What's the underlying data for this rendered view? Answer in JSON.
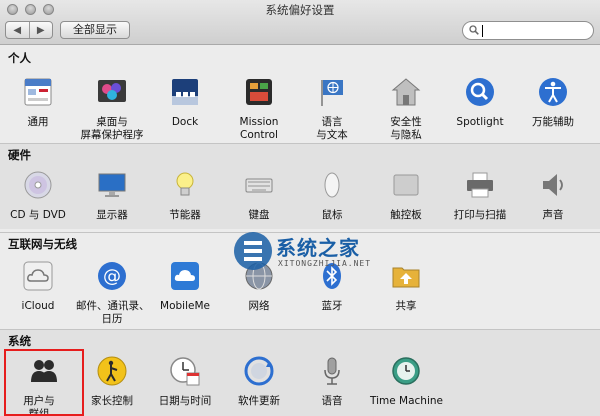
{
  "window": {
    "title": "系统偏好设置"
  },
  "toolbar": {
    "back": "◀",
    "forward": "▶",
    "show_all": "全部显示",
    "search_value": ""
  },
  "sections": [
    {
      "label": "个人",
      "items": [
        {
          "id": "general",
          "label": "通用"
        },
        {
          "id": "desktop",
          "label": "桌面与",
          "label2": "屏幕保护程序"
        },
        {
          "id": "dock",
          "label": "Dock"
        },
        {
          "id": "mission",
          "label": "Mission",
          "label2": "Control"
        },
        {
          "id": "language",
          "label": "语言",
          "label2": "与文本"
        },
        {
          "id": "security",
          "label": "安全性",
          "label2": "与隐私"
        },
        {
          "id": "spotlight",
          "label": "Spotlight"
        },
        {
          "id": "accessibility",
          "label": "万能辅助"
        }
      ]
    },
    {
      "label": "硬件",
      "items": [
        {
          "id": "cddvd",
          "label": "CD 与 DVD"
        },
        {
          "id": "display",
          "label": "显示器"
        },
        {
          "id": "energy",
          "label": "节能器"
        },
        {
          "id": "keyboard",
          "label": "键盘"
        },
        {
          "id": "mouse",
          "label": "鼠标"
        },
        {
          "id": "trackpad",
          "label": "触控板"
        },
        {
          "id": "print",
          "label": "打印与扫描"
        },
        {
          "id": "sound",
          "label": "声音"
        }
      ]
    },
    {
      "label": "互联网与无线",
      "items": [
        {
          "id": "icloud",
          "label": "iCloud"
        },
        {
          "id": "mail",
          "label": "邮件、通讯录、",
          "label2": "日历"
        },
        {
          "id": "mobileme",
          "label": "MobileMe"
        },
        {
          "id": "network",
          "label": "网络"
        },
        {
          "id": "bluetooth",
          "label": "蓝牙"
        },
        {
          "id": "sharing",
          "label": "共享"
        }
      ]
    },
    {
      "label": "系统",
      "items": [
        {
          "id": "users",
          "label": "用户与",
          "label2": "群组"
        },
        {
          "id": "parental",
          "label": "家长控制"
        },
        {
          "id": "datetime",
          "label": "日期与时间"
        },
        {
          "id": "update",
          "label": "软件更新"
        },
        {
          "id": "speech",
          "label": "语音"
        },
        {
          "id": "timemachine",
          "label": "Time Machine"
        }
      ]
    }
  ],
  "watermark": {
    "text": "系统之家",
    "sub": "XITONGZHIJIA.NET"
  },
  "colors": {
    "accent": "#1a5fa6",
    "highlight": "#e61d1d"
  }
}
